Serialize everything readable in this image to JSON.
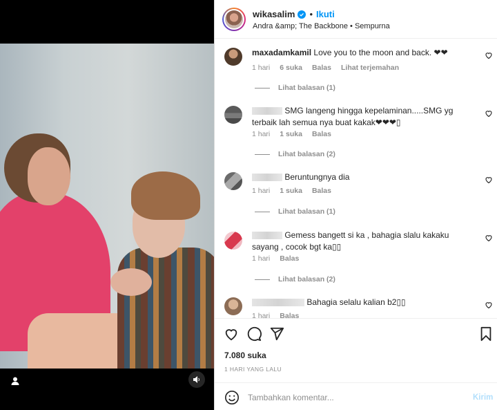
{
  "post": {
    "username": "wikasalim",
    "follow_label": "Ikuti",
    "dot": "•",
    "audio": "Andra &amp; The Backbone • Sempurna"
  },
  "comments": [
    {
      "username": "maxadamkamil",
      "text": "Love you to the moon and back. ❤❤",
      "time": "1 hari",
      "likes": "6 suka",
      "reply_label": "Balas",
      "translate_label": "Lihat terjemahan",
      "view_replies": "Lihat balasan (1)"
    },
    {
      "username": "",
      "text": "SMG langeng hingga kepelaminan.....SMG yg terbaik lah semua nya buat kakak❤❤❤▯",
      "time": "1 hari",
      "likes": "1 suka",
      "reply_label": "Balas",
      "view_replies": "Lihat balasan (2)"
    },
    {
      "username": "",
      "text": "Beruntungnya dia",
      "time": "1 hari",
      "likes": "1 suka",
      "reply_label": "Balas",
      "view_replies": "Lihat balasan (1)"
    },
    {
      "username": "",
      "text": "Gemess bangett si ka , bahagia slalu kakaku sayang , cocok bgt ka▯▯",
      "time": "1 hari",
      "reply_label": "Balas",
      "view_replies": "Lihat balasan (2)"
    },
    {
      "username": "",
      "text": "Bahagia selalu kalian b2▯▯",
      "time": "1 hari",
      "reply_label": "Balas"
    }
  ],
  "actions": {
    "likes": "7.080 suka",
    "time_ago": "1 HARI YANG LALU"
  },
  "composer": {
    "placeholder": "Tambahkan komentar...",
    "post_label": "Kirim"
  },
  "icons": {
    "like": "heart-icon",
    "comment": "comment-icon",
    "share": "share-icon",
    "save": "bookmark-icon",
    "emoji": "emoji-icon",
    "tagged": "user-icon",
    "sound": "speaker-icon",
    "verified": "verified-badge-icon"
  },
  "colors": {
    "accent": "#0095f6",
    "muted": "#8e8e8e",
    "post_disabled": "#b2dffc"
  }
}
